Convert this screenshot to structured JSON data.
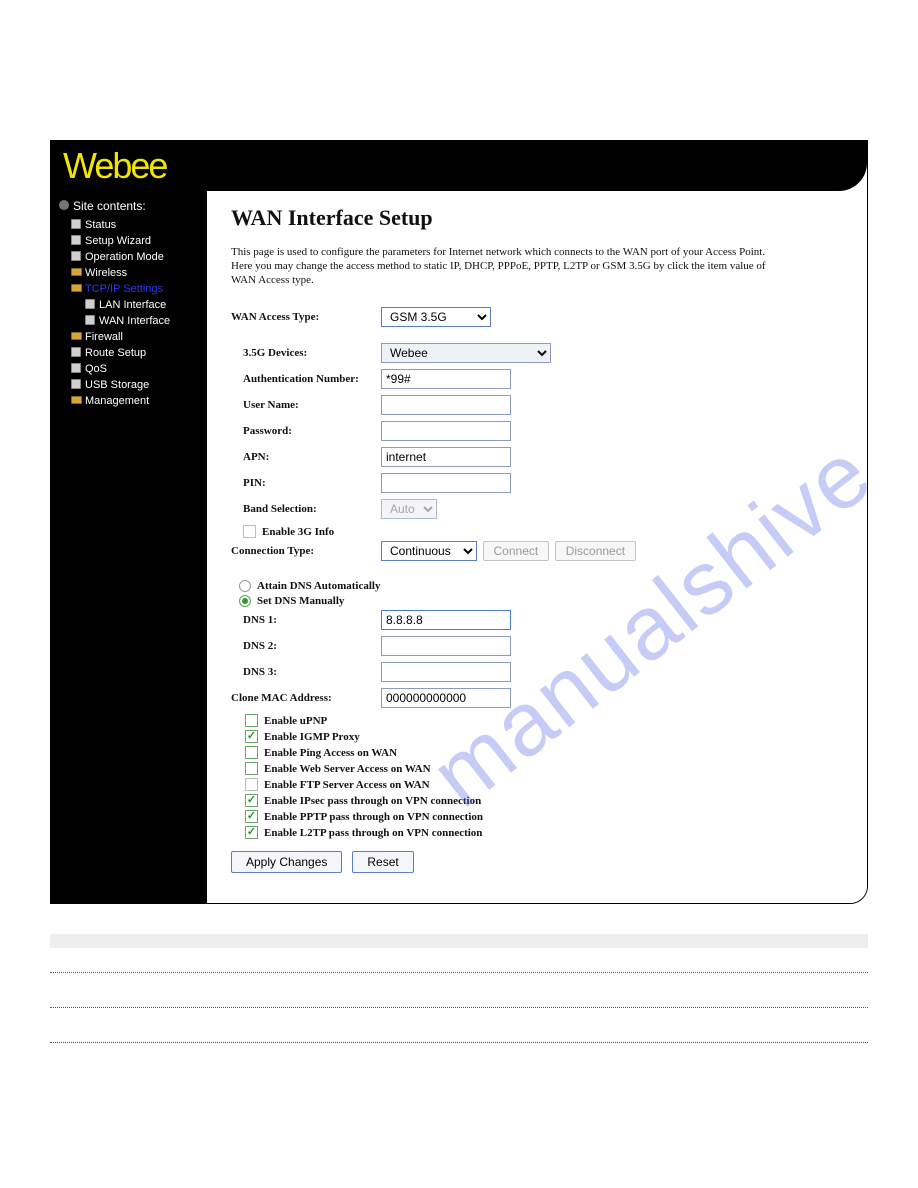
{
  "brand": "Webee",
  "watermark": "manualshive.com",
  "sidebar": {
    "title": "Site contents:",
    "items": [
      {
        "label": "Status",
        "icon": "page"
      },
      {
        "label": "Setup Wizard",
        "icon": "page"
      },
      {
        "label": "Operation Mode",
        "icon": "page"
      },
      {
        "label": "Wireless",
        "icon": "folder"
      },
      {
        "label": "TCP/IP Settings",
        "icon": "folder-open",
        "active": true
      },
      {
        "label": "LAN Interface",
        "icon": "page",
        "sub": true
      },
      {
        "label": "WAN Interface",
        "icon": "page",
        "sub": true
      },
      {
        "label": "Firewall",
        "icon": "folder"
      },
      {
        "label": "Route Setup",
        "icon": "page"
      },
      {
        "label": "QoS",
        "icon": "page"
      },
      {
        "label": "USB Storage",
        "icon": "page"
      },
      {
        "label": "Management",
        "icon": "folder"
      }
    ]
  },
  "page": {
    "title": "WAN Interface Setup",
    "description": "This page is used to configure the parameters for Internet network which connects to the WAN port of your Access Point. Here you may change the access method to static IP, DHCP, PPPoE, PPTP, L2TP or GSM 3.5G by click the item value of WAN Access type."
  },
  "form": {
    "wan_access_label": "WAN Access Type:",
    "wan_access_value": "GSM 3.5G",
    "devices_label": "3.5G Devices:",
    "devices_value": "Webee",
    "auth_label": "Authentication Number:",
    "auth_value": "*99#",
    "user_label": "User Name:",
    "user_value": "",
    "pass_label": "Password:",
    "pass_value": "",
    "apn_label": "APN:",
    "apn_value": "internet",
    "pin_label": "PIN:",
    "pin_value": "",
    "band_label": "Band Selection:",
    "band_value": "Auto",
    "enable3g_label": "Enable 3G Info",
    "conn_label": "Connection Type:",
    "conn_value": "Continuous",
    "connect_btn": "Connect",
    "disconnect_btn": "Disconnect",
    "dns_auto_label": "Attain DNS Automatically",
    "dns_manual_label": "Set DNS Manually",
    "dns1_label": "DNS 1:",
    "dns1_value": "8.8.8.8",
    "dns2_label": "DNS 2:",
    "dns2_value": "",
    "dns3_label": "DNS 3:",
    "dns3_value": "",
    "mac_label": "Clone MAC Address:",
    "mac_value": "000000000000",
    "checks": [
      {
        "label": "Enable uPNP",
        "checked": false
      },
      {
        "label": "Enable IGMP Proxy",
        "checked": true
      },
      {
        "label": "Enable Ping Access on WAN",
        "checked": false
      },
      {
        "label": "Enable Web Server Access on WAN",
        "checked": false
      },
      {
        "label": "Enable FTP Server Access on WAN",
        "checked": false,
        "disabled": true
      },
      {
        "label": "Enable IPsec pass through on VPN connection",
        "checked": true
      },
      {
        "label": "Enable PPTP pass through on VPN connection",
        "checked": true
      },
      {
        "label": "Enable L2TP pass through on VPN connection",
        "checked": true
      }
    ],
    "apply_btn": "Apply Changes",
    "reset_btn": "Reset"
  }
}
